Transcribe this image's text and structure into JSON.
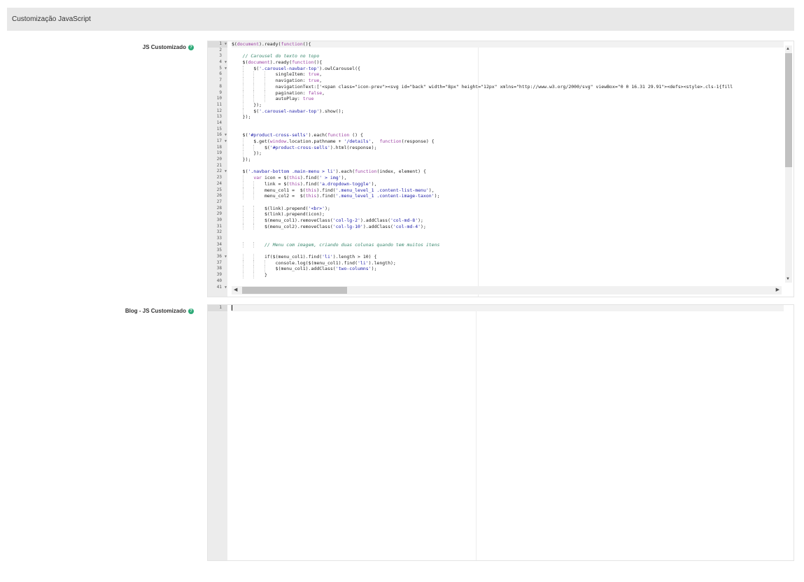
{
  "section": {
    "title": "Customização JavaScript"
  },
  "fields": {
    "js": {
      "label": "JS Customizado",
      "help": "?"
    },
    "blog": {
      "label": "Blog - JS Customizado",
      "help": "?"
    }
  },
  "editor1": {
    "lines": [
      {
        "n": "1",
        "fold": true,
        "t": "$(document).ready(function(){"
      },
      {
        "n": "2",
        "t": ""
      },
      {
        "n": "3",
        "t": "    // Carousel do texto no topo"
      },
      {
        "n": "4",
        "fold": true,
        "t": "    $(document).ready(function(){"
      },
      {
        "n": "5",
        "fold": true,
        "t": "        $('.carousel-navbar-top').owlCarousel({"
      },
      {
        "n": "6",
        "t": "                singleItem: true,"
      },
      {
        "n": "7",
        "t": "                navigation: true,"
      },
      {
        "n": "8",
        "t": "                navigationText:['<span class=\"icon-prev\"><svg id=\"back\" width=\"8px\" height=\"12px\" xmlns=\"http://www.w3.org/2000/svg\" viewBox=\"0 0 16.31 29.91\"><defs><style>.cls-1{fill"
      },
      {
        "n": "9",
        "t": "                pagination: false,"
      },
      {
        "n": "10",
        "t": "                autoPlay: true"
      },
      {
        "n": "11",
        "t": "        });"
      },
      {
        "n": "12",
        "t": "        $('.carousel-navbar-top').show();"
      },
      {
        "n": "13",
        "t": "    });"
      },
      {
        "n": "14",
        "t": ""
      },
      {
        "n": "15",
        "t": ""
      },
      {
        "n": "16",
        "fold": true,
        "t": "    $('#product-cross-sells').each(function () {"
      },
      {
        "n": "17",
        "fold": true,
        "t": "        $.get(window.location.pathname + '/details',  function(response) {"
      },
      {
        "n": "18",
        "t": "            $('#product-cross-sells').html(response);"
      },
      {
        "n": "19",
        "t": "        });"
      },
      {
        "n": "20",
        "t": "    });"
      },
      {
        "n": "21",
        "t": ""
      },
      {
        "n": "22",
        "fold": true,
        "t": "    $('.navbar-bottom .main-menu > li').each(function(index, element) {"
      },
      {
        "n": "23",
        "t": "        var icon = $(this).find(' > img'),"
      },
      {
        "n": "24",
        "t": "            link = $(this).find('a.dropdown-toggle'),"
      },
      {
        "n": "25",
        "t": "            menu_col1 =  $(this).find('.menu_level_1 .content-list-menu'),"
      },
      {
        "n": "26",
        "t": "            menu_col2 =  $(this).find('.menu_level_1 .content-image-taxon');"
      },
      {
        "n": "27",
        "t": ""
      },
      {
        "n": "28",
        "t": "            $(link).prepend('<br>');"
      },
      {
        "n": "29",
        "t": "            $(link).prepend(icon);"
      },
      {
        "n": "30",
        "t": "            $(menu_col1).removeClass('col-lg-2').addClass('col-md-8');"
      },
      {
        "n": "31",
        "t": "            $(menu_col2).removeClass('col-lg-10').addClass('col-md-4');"
      },
      {
        "n": "32",
        "t": ""
      },
      {
        "n": "33",
        "t": ""
      },
      {
        "n": "34",
        "t": "            // Menu com imagem, criando duas colunas quando tem muitos itens"
      },
      {
        "n": "35",
        "t": ""
      },
      {
        "n": "36",
        "fold": true,
        "t": "            if($(menu_col1).find('li').length > 10) {"
      },
      {
        "n": "37",
        "t": "                console.log($(menu_col1).find('li').length);"
      },
      {
        "n": "38",
        "t": "                $(menu_col1).addClass('two-columns');"
      },
      {
        "n": "39",
        "t": "            }"
      },
      {
        "n": "40",
        "t": ""
      },
      {
        "n": "41",
        "fold": true,
        "t": ""
      }
    ]
  },
  "editor2": {
    "lines": [
      {
        "n": "1",
        "t": ""
      }
    ]
  }
}
